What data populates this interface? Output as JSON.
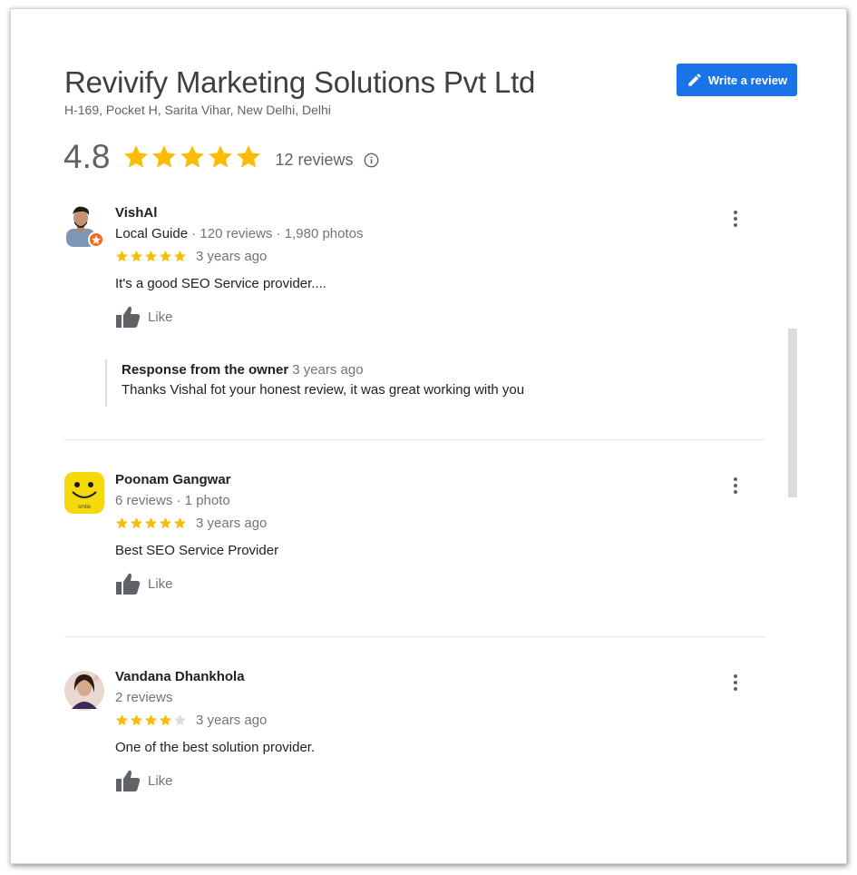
{
  "business": {
    "name": "Revivify Marketing Solutions Pvt Ltd",
    "address": "H-169, Pocket H, Sarita Vihar, New Delhi, Delhi",
    "rating": "4.8",
    "stars": 5,
    "review_count": "12 reviews",
    "write_review_label": "Write a review"
  },
  "colors": {
    "accent": "#1a73e8",
    "star": "#fbbc04",
    "star_empty": "#dadce0",
    "guide_badge": "#f26b1d"
  },
  "icons": [
    "pencil-icon",
    "star-icon",
    "info-icon",
    "more-vert-icon",
    "thumbs-up-icon"
  ],
  "reviews": [
    {
      "name": "VishAl",
      "local_guide": "Local Guide",
      "meta": " · 120 reviews · 1,980 photos",
      "rating": 5,
      "date": "3 years ago",
      "text": "It's a good SEO Service provider....",
      "like_label": "Like",
      "owner_response": {
        "title": "Response from the owner",
        "date": "3 years ago",
        "text": "Thanks Vishal fot your honest review, it was great working with you"
      }
    },
    {
      "name": "Poonam Gangwar",
      "meta": "6 reviews · 1 photo",
      "rating": 5,
      "date": "3 years ago",
      "text": "Best SEO Service Provider",
      "like_label": "Like",
      "avatar_text": "smile"
    },
    {
      "name": "Vandana Dhankhola",
      "meta": "2 reviews",
      "rating": 4,
      "date": "3 years ago",
      "text": "One of the best solution provider.",
      "like_label": "Like"
    }
  ]
}
